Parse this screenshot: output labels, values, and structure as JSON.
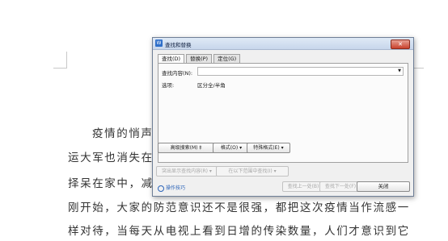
{
  "document": {
    "lines": [
      "疫情的悄声",
      "运大军也消失在",
      "择呆在家中，减",
      "刚开始，大家的防范意识还不是很强，都把这次疫情当作流感一",
      "样对待，当每天从电视上看到日增的传染数量，人们才意识到它"
    ]
  },
  "dialog": {
    "title": "查找和替换",
    "close_label": "✕",
    "tabs": [
      {
        "label": "查找(D)"
      },
      {
        "label": "替换(P)"
      },
      {
        "label": "定位(G)"
      }
    ],
    "find_label": "查找内容(N):",
    "find_value": "",
    "options_label": "选项:",
    "options_value": "区分全/半角",
    "advanced_search": "高级搜索(M) ‡",
    "format": "格式(O) ▾",
    "special_format": "特殊格式(E) ▾",
    "highlight_all": "突出显示查找内容(R) ▾",
    "find_in": "在以下范围中查找(I) ▾",
    "tips": "操作技巧",
    "find_previous": "查找上一处(B)",
    "find_next": "查找下一处(F)",
    "close": "关闭"
  }
}
